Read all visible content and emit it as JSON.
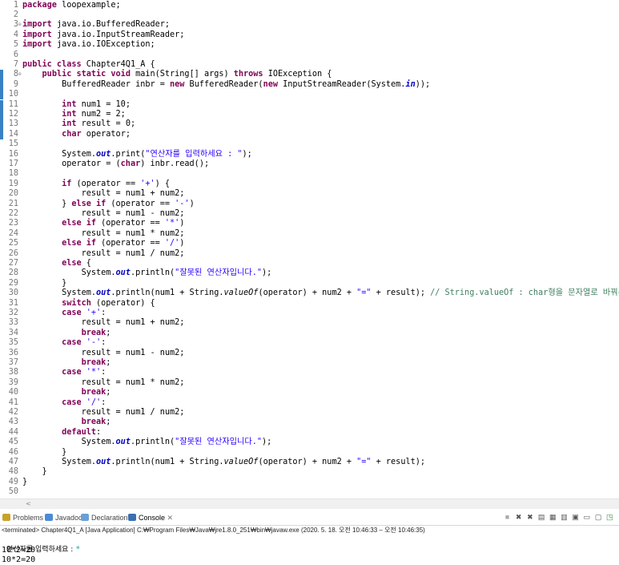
{
  "editor": {
    "lines": [
      {
        "n": "1",
        "fold": "",
        "mark": false,
        "tokens": [
          {
            "t": "kw",
            "v": "package"
          },
          {
            "t": "",
            "v": " loopexample;"
          }
        ]
      },
      {
        "n": "2",
        "fold": "",
        "mark": false,
        "tokens": []
      },
      {
        "n": "3",
        "fold": "⊖",
        "mark": false,
        "tokens": [
          {
            "t": "kw",
            "v": "import"
          },
          {
            "t": "",
            "v": " java.io.BufferedReader;"
          }
        ]
      },
      {
        "n": "4",
        "fold": "",
        "mark": false,
        "tokens": [
          {
            "t": "kw",
            "v": "import"
          },
          {
            "t": "",
            "v": " java.io.InputStreamReader;"
          }
        ]
      },
      {
        "n": "5",
        "fold": "",
        "mark": false,
        "tokens": [
          {
            "t": "kw",
            "v": "import"
          },
          {
            "t": "",
            "v": " java.io.IOException;"
          }
        ]
      },
      {
        "n": "6",
        "fold": "",
        "mark": false,
        "tokens": []
      },
      {
        "n": "7",
        "fold": "",
        "mark": false,
        "tokens": [
          {
            "t": "kw",
            "v": "public class"
          },
          {
            "t": "",
            "v": " Chapter4Q1_A {"
          }
        ]
      },
      {
        "n": "8",
        "fold": "⊖",
        "mark": true,
        "tokens": [
          {
            "t": "",
            "v": "    "
          },
          {
            "t": "kw",
            "v": "public static void"
          },
          {
            "t": "",
            "v": " main(String[] args) "
          },
          {
            "t": "kw",
            "v": "throws"
          },
          {
            "t": "",
            "v": " IOException {"
          }
        ]
      },
      {
        "n": "9",
        "fold": "",
        "mark": true,
        "tokens": [
          {
            "t": "",
            "v": "        BufferedReader inbr = "
          },
          {
            "t": "kw",
            "v": "new"
          },
          {
            "t": "",
            "v": " BufferedReader("
          },
          {
            "t": "kw",
            "v": "new"
          },
          {
            "t": "",
            "v": " InputStreamReader(System."
          },
          {
            "t": "fld",
            "v": "in"
          },
          {
            "t": "",
            "v": "));"
          }
        ]
      },
      {
        "n": "10",
        "fold": "",
        "mark": true,
        "tokens": []
      },
      {
        "n": "11",
        "fold": "",
        "mark": true,
        "tokens": [
          {
            "t": "",
            "v": "        "
          },
          {
            "t": "kw",
            "v": "int"
          },
          {
            "t": "",
            "v": " num1 = 10;"
          }
        ]
      },
      {
        "n": "12",
        "fold": "",
        "mark": true,
        "tokens": [
          {
            "t": "",
            "v": "        "
          },
          {
            "t": "kw",
            "v": "int"
          },
          {
            "t": "",
            "v": " num2 = 2;"
          }
        ]
      },
      {
        "n": "13",
        "fold": "",
        "mark": true,
        "tokens": [
          {
            "t": "",
            "v": "        "
          },
          {
            "t": "kw",
            "v": "int"
          },
          {
            "t": "",
            "v": " result = 0;"
          }
        ]
      },
      {
        "n": "14",
        "fold": "",
        "mark": true,
        "tokens": [
          {
            "t": "",
            "v": "        "
          },
          {
            "t": "kw",
            "v": "char"
          },
          {
            "t": "",
            "v": " operator;"
          }
        ]
      },
      {
        "n": "15",
        "fold": "",
        "mark": false,
        "tokens": []
      },
      {
        "n": "16",
        "fold": "",
        "mark": false,
        "tokens": [
          {
            "t": "",
            "v": "        System."
          },
          {
            "t": "fld",
            "v": "out"
          },
          {
            "t": "",
            "v": ".print("
          },
          {
            "t": "str",
            "v": "\"연산자를 입력하세요 : \""
          },
          {
            "t": "",
            "v": ");"
          }
        ]
      },
      {
        "n": "17",
        "fold": "",
        "mark": false,
        "tokens": [
          {
            "t": "",
            "v": "        operator = ("
          },
          {
            "t": "kw",
            "v": "char"
          },
          {
            "t": "",
            "v": ") inbr.read();"
          }
        ]
      },
      {
        "n": "18",
        "fold": "",
        "mark": false,
        "tokens": []
      },
      {
        "n": "19",
        "fold": "",
        "mark": false,
        "tokens": [
          {
            "t": "",
            "v": "        "
          },
          {
            "t": "kw",
            "v": "if"
          },
          {
            "t": "",
            "v": " (operator == "
          },
          {
            "t": "str",
            "v": "'+'"
          },
          {
            "t": "",
            "v": ") {"
          }
        ]
      },
      {
        "n": "20",
        "fold": "",
        "mark": false,
        "tokens": [
          {
            "t": "",
            "v": "            result = num1 + num2;"
          }
        ]
      },
      {
        "n": "21",
        "fold": "",
        "mark": false,
        "tokens": [
          {
            "t": "",
            "v": "        } "
          },
          {
            "t": "kw",
            "v": "else if"
          },
          {
            "t": "",
            "v": " (operator == "
          },
          {
            "t": "str",
            "v": "'-'"
          },
          {
            "t": "",
            "v": ")"
          }
        ]
      },
      {
        "n": "22",
        "fold": "",
        "mark": false,
        "tokens": [
          {
            "t": "",
            "v": "            result = num1 - num2;"
          }
        ]
      },
      {
        "n": "23",
        "fold": "",
        "mark": false,
        "tokens": [
          {
            "t": "",
            "v": "        "
          },
          {
            "t": "kw",
            "v": "else if"
          },
          {
            "t": "",
            "v": " (operator == "
          },
          {
            "t": "str",
            "v": "'*'"
          },
          {
            "t": "",
            "v": ")"
          }
        ]
      },
      {
        "n": "24",
        "fold": "",
        "mark": false,
        "tokens": [
          {
            "t": "",
            "v": "            result = num1 * num2;"
          }
        ]
      },
      {
        "n": "25",
        "fold": "",
        "mark": false,
        "tokens": [
          {
            "t": "",
            "v": "        "
          },
          {
            "t": "kw",
            "v": "else if"
          },
          {
            "t": "",
            "v": " (operator == "
          },
          {
            "t": "str",
            "v": "'/'"
          },
          {
            "t": "",
            "v": ")"
          }
        ]
      },
      {
        "n": "26",
        "fold": "",
        "mark": false,
        "tokens": [
          {
            "t": "",
            "v": "            result = num1 / num2;"
          }
        ]
      },
      {
        "n": "27",
        "fold": "",
        "mark": false,
        "tokens": [
          {
            "t": "",
            "v": "        "
          },
          {
            "t": "kw",
            "v": "else"
          },
          {
            "t": "",
            "v": " {"
          }
        ]
      },
      {
        "n": "28",
        "fold": "",
        "mark": false,
        "tokens": [
          {
            "t": "",
            "v": "            System."
          },
          {
            "t": "fld",
            "v": "out"
          },
          {
            "t": "",
            "v": ".println("
          },
          {
            "t": "str",
            "v": "\"잘못된 연산자입니다.\""
          },
          {
            "t": "",
            "v": ");"
          }
        ]
      },
      {
        "n": "29",
        "fold": "",
        "mark": false,
        "tokens": [
          {
            "t": "",
            "v": "        }"
          }
        ]
      },
      {
        "n": "30",
        "fold": "",
        "mark": false,
        "tokens": [
          {
            "t": "",
            "v": "        System."
          },
          {
            "t": "fld",
            "v": "out"
          },
          {
            "t": "",
            "v": ".println(num1 + String."
          },
          {
            "t": "mth",
            "v": "valueOf"
          },
          {
            "t": "",
            "v": "(operator) + num2 + "
          },
          {
            "t": "str",
            "v": "\"=\""
          },
          {
            "t": "",
            "v": " + result); "
          },
          {
            "t": "cmt",
            "v": "// String.valueOf : char형을 문자열로 바꿔주는 메소드"
          }
        ]
      },
      {
        "n": "31",
        "fold": "",
        "mark": false,
        "tokens": [
          {
            "t": "",
            "v": "        "
          },
          {
            "t": "kw",
            "v": "switch"
          },
          {
            "t": "",
            "v": " (operator) {"
          }
        ]
      },
      {
        "n": "32",
        "fold": "",
        "mark": false,
        "tokens": [
          {
            "t": "",
            "v": "        "
          },
          {
            "t": "kw",
            "v": "case"
          },
          {
            "t": "",
            "v": " "
          },
          {
            "t": "str",
            "v": "'+'"
          },
          {
            "t": "",
            "v": ":"
          }
        ]
      },
      {
        "n": "33",
        "fold": "",
        "mark": false,
        "tokens": [
          {
            "t": "",
            "v": "            result = num1 + num2;"
          }
        ]
      },
      {
        "n": "34",
        "fold": "",
        "mark": false,
        "tokens": [
          {
            "t": "",
            "v": "            "
          },
          {
            "t": "kw",
            "v": "break"
          },
          {
            "t": "",
            "v": ";"
          }
        ]
      },
      {
        "n": "35",
        "fold": "",
        "mark": false,
        "tokens": [
          {
            "t": "",
            "v": "        "
          },
          {
            "t": "kw",
            "v": "case"
          },
          {
            "t": "",
            "v": " "
          },
          {
            "t": "str",
            "v": "'-'"
          },
          {
            "t": "",
            "v": ":"
          }
        ]
      },
      {
        "n": "36",
        "fold": "",
        "mark": false,
        "tokens": [
          {
            "t": "",
            "v": "            result = num1 - num2;"
          }
        ]
      },
      {
        "n": "37",
        "fold": "",
        "mark": false,
        "tokens": [
          {
            "t": "",
            "v": "            "
          },
          {
            "t": "kw",
            "v": "break"
          },
          {
            "t": "",
            "v": ";"
          }
        ]
      },
      {
        "n": "38",
        "fold": "",
        "mark": false,
        "tokens": [
          {
            "t": "",
            "v": "        "
          },
          {
            "t": "kw",
            "v": "case"
          },
          {
            "t": "",
            "v": " "
          },
          {
            "t": "str",
            "v": "'*'"
          },
          {
            "t": "",
            "v": ":"
          }
        ]
      },
      {
        "n": "39",
        "fold": "",
        "mark": false,
        "tokens": [
          {
            "t": "",
            "v": "            result = num1 * num2;"
          }
        ]
      },
      {
        "n": "40",
        "fold": "",
        "mark": false,
        "tokens": [
          {
            "t": "",
            "v": "            "
          },
          {
            "t": "kw",
            "v": "break"
          },
          {
            "t": "",
            "v": ";"
          }
        ]
      },
      {
        "n": "41",
        "fold": "",
        "mark": false,
        "tokens": [
          {
            "t": "",
            "v": "        "
          },
          {
            "t": "kw",
            "v": "case"
          },
          {
            "t": "",
            "v": " "
          },
          {
            "t": "str",
            "v": "'/'"
          },
          {
            "t": "",
            "v": ":"
          }
        ]
      },
      {
        "n": "42",
        "fold": "",
        "mark": false,
        "tokens": [
          {
            "t": "",
            "v": "            result = num1 / num2;"
          }
        ]
      },
      {
        "n": "43",
        "fold": "",
        "mark": false,
        "tokens": [
          {
            "t": "",
            "v": "            "
          },
          {
            "t": "kw",
            "v": "break"
          },
          {
            "t": "",
            "v": ";"
          }
        ]
      },
      {
        "n": "44",
        "fold": "",
        "mark": false,
        "tokens": [
          {
            "t": "",
            "v": "        "
          },
          {
            "t": "kw",
            "v": "default"
          },
          {
            "t": "",
            "v": ":"
          }
        ]
      },
      {
        "n": "45",
        "fold": "",
        "mark": false,
        "tokens": [
          {
            "t": "",
            "v": "            System."
          },
          {
            "t": "fld",
            "v": "out"
          },
          {
            "t": "",
            "v": ".println("
          },
          {
            "t": "str",
            "v": "\"잘못된 연산자입니다.\""
          },
          {
            "t": "",
            "v": ");"
          }
        ]
      },
      {
        "n": "46",
        "fold": "",
        "mark": false,
        "tokens": [
          {
            "t": "",
            "v": "        }"
          }
        ]
      },
      {
        "n": "47",
        "fold": "",
        "mark": false,
        "tokens": [
          {
            "t": "",
            "v": "        System."
          },
          {
            "t": "fld",
            "v": "out"
          },
          {
            "t": "",
            "v": ".println(num1 + String."
          },
          {
            "t": "mth",
            "v": "valueOf"
          },
          {
            "t": "",
            "v": "(operator) + num2 + "
          },
          {
            "t": "str",
            "v": "\"=\""
          },
          {
            "t": "",
            "v": " + result);"
          }
        ]
      },
      {
        "n": "48",
        "fold": "",
        "mark": false,
        "tokens": [
          {
            "t": "",
            "v": "    }"
          }
        ]
      },
      {
        "n": "49",
        "fold": "",
        "mark": false,
        "tokens": [
          {
            "t": "",
            "v": "}"
          }
        ]
      },
      {
        "n": "50",
        "fold": "",
        "mark": false,
        "tokens": []
      }
    ]
  },
  "tabs": [
    {
      "label": "Problems",
      "icon": "problems-icon",
      "color": "#c9a227",
      "active": false
    },
    {
      "label": "Javadoc",
      "icon": "javadoc-icon",
      "color": "#4a8bd6",
      "active": false
    },
    {
      "label": "Declaration",
      "icon": "declaration-icon",
      "color": "#6aa0d6",
      "active": false
    },
    {
      "label": "Console",
      "icon": "console-icon",
      "color": "#3a6fb0",
      "active": true
    }
  ],
  "tab_close": "✕",
  "toolbar": [
    {
      "icon": "terminate-icon",
      "glyph": "■"
    },
    {
      "icon": "remove-launch-icon",
      "glyph": "✖"
    },
    {
      "icon": "remove-all-icon",
      "glyph": "✖"
    },
    {
      "icon": "clear-console-icon",
      "glyph": "▤"
    },
    {
      "icon": "scroll-lock-icon",
      "glyph": "▦"
    },
    {
      "icon": "word-wrap-icon",
      "glyph": "▥"
    },
    {
      "icon": "pin-console-icon",
      "glyph": "▣"
    },
    {
      "icon": "display-console-icon",
      "glyph": "▭"
    },
    {
      "icon": "open-console-icon",
      "glyph": "▢"
    },
    {
      "icon": "new-console-icon",
      "glyph": "◳"
    }
  ],
  "console": {
    "status": "<terminated> Chapter4Q1_A [Java Application] C:₩Program Files₩Java₩jre1.8.0_251₩bin₩javaw.exe  (2020. 5. 18. 오전 10:46:33 – 오전 10:46:35)",
    "prompt": "연산자를 입력하세요 : ",
    "input": "*",
    "output": [
      "10*2=20",
      "10*2=20"
    ]
  }
}
